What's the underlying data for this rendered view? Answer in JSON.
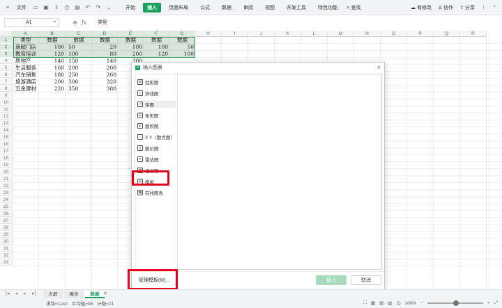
{
  "menubar": {
    "file_label": "文件",
    "tabs": [
      {
        "label": "开始",
        "active": false
      },
      {
        "label": "插入",
        "active": true
      },
      {
        "label": "页面布局",
        "active": false
      },
      {
        "label": "公式",
        "active": false
      },
      {
        "label": "数据",
        "active": false
      },
      {
        "label": "审阅",
        "active": false
      },
      {
        "label": "视图",
        "active": false
      },
      {
        "label": "开发工具",
        "active": false
      },
      {
        "label": "特色功能",
        "active": false
      }
    ],
    "search_label": "查找",
    "unsaved_label": "有修改",
    "collab_label": "协作",
    "share_label": "分享"
  },
  "formula_bar": {
    "cell_ref": "A1",
    "formula": "类型"
  },
  "sheet": {
    "columns": [
      "A",
      "B",
      "C",
      "D",
      "E",
      "F",
      "G",
      "H",
      "I",
      "J",
      "K",
      "L",
      "M",
      "N",
      "O",
      "P",
      "Q",
      "R"
    ],
    "rows": [
      [
        "类型",
        "数据",
        "数据",
        "数据",
        "数据",
        "数据",
        "数据"
      ],
      [
        "商超门店",
        "100",
        "50",
        "20",
        "100",
        "100",
        "50"
      ],
      [
        "教育培训",
        "120",
        "100",
        "80",
        "200",
        "120",
        "100"
      ],
      [
        "房地产",
        "140",
        "150",
        "140",
        "300",
        "",
        ""
      ],
      [
        "生活服务",
        "160",
        "200",
        "200",
        "50",
        "",
        ""
      ],
      [
        "汽车销售",
        "180",
        "250",
        "260",
        "90",
        "",
        ""
      ],
      [
        "旅游酒店",
        "200",
        "300",
        "320",
        "70",
        "",
        ""
      ],
      [
        "五金建材",
        "220",
        "350",
        "380",
        "40",
        "",
        ""
      ]
    ],
    "row_count": 33
  },
  "dialog": {
    "title": "插入图表",
    "close": "×",
    "chart_types": [
      {
        "label": "柱形图",
        "icon": "column-chart-icon"
      },
      {
        "label": "折线图",
        "icon": "line-chart-icon"
      },
      {
        "label": "饼图",
        "icon": "pie-chart-icon"
      },
      {
        "label": "条形图",
        "icon": "bar-chart-icon"
      },
      {
        "label": "面积图",
        "icon": "area-chart-icon"
      },
      {
        "label": "X Y（散点图）",
        "icon": "scatter-chart-icon"
      },
      {
        "label": "股价图",
        "icon": "stock-chart-icon"
      },
      {
        "label": "雷达图",
        "icon": "radar-chart-icon"
      },
      {
        "label": "组合图",
        "icon": "combo-chart-icon"
      },
      {
        "label": "模板",
        "icon": "template-icon"
      },
      {
        "label": "在线图表",
        "icon": "online-chart-icon"
      }
    ],
    "manage_templates_label": "管理模板(M)...",
    "insert_label": "插入",
    "cancel_label": "取消"
  },
  "sheet_tabs": [
    {
      "label": "大屏",
      "active": false
    },
    {
      "label": "展示",
      "active": false
    },
    {
      "label": "数据",
      "active": true
    }
  ],
  "status": {
    "sum": "求和=1140",
    "average": "平均值=95",
    "count": "计数=21",
    "zoom": "100%"
  },
  "colors": {
    "accent": "#1aa15f",
    "highlight": "#e8001c"
  }
}
